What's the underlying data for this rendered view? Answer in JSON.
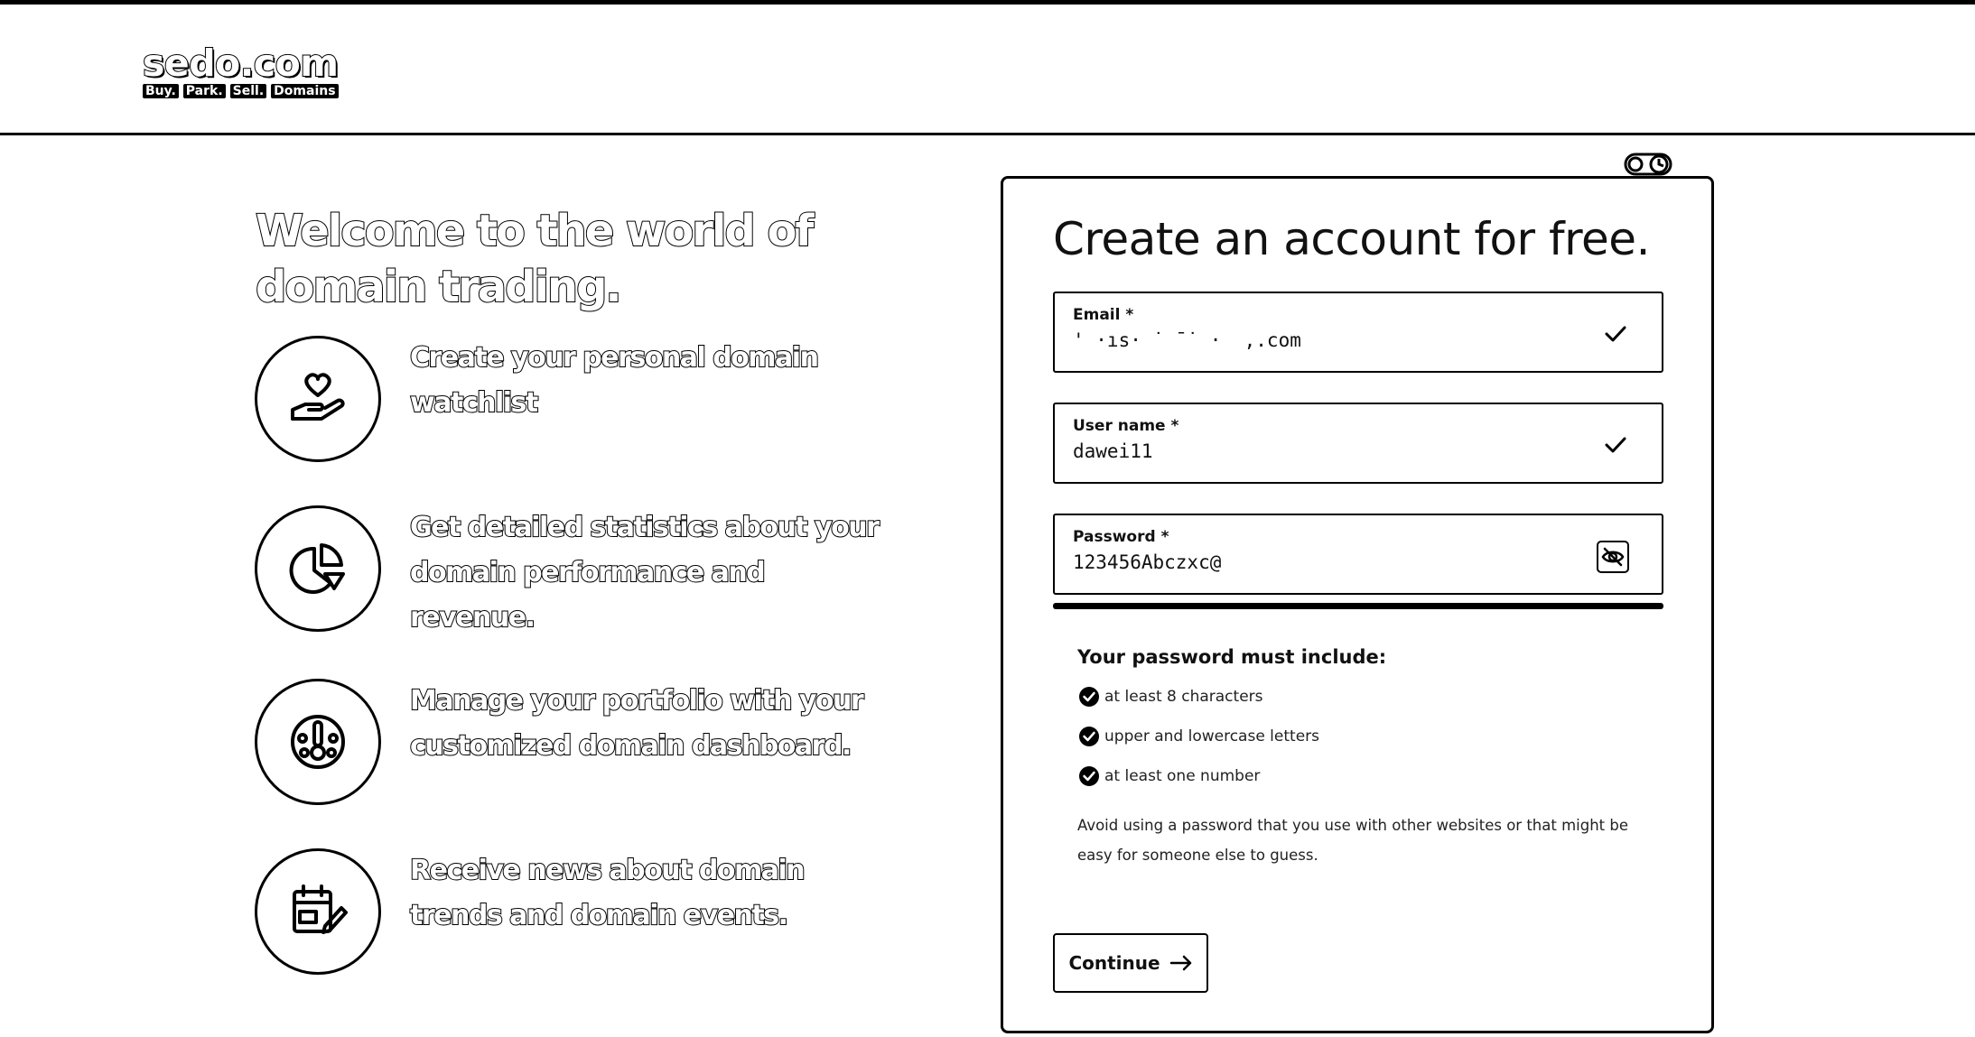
{
  "header": {
    "logo": {
      "word": "sedo.com",
      "tags": [
        "Buy.",
        "Park.",
        "Sell.",
        "Domains"
      ]
    }
  },
  "hero": {
    "title": "Welcome to the world of domain trading."
  },
  "features": [
    {
      "icon": "hand-heart-icon",
      "text": "Create your personal domain watchlist"
    },
    {
      "icon": "pie-chart-icon",
      "text": "Get detailed statistics about your domain performance and revenue."
    },
    {
      "icon": "dashboard-gauge-icon",
      "text": "Manage your portfolio with your customized domain dashboard."
    },
    {
      "icon": "calendar-edit-icon",
      "text": "Receive news about domain trends and domain events."
    }
  ],
  "form": {
    "title": "Create an account for free.",
    "email": {
      "label": "Email *",
      "value": "' ·ıs· ˙ ˉ˙ ·  ,.com",
      "status_icon": "check-icon"
    },
    "username": {
      "label": "User name *",
      "value": "dawei11",
      "status_icon": "check-icon"
    },
    "password": {
      "label": "Password *",
      "value": "123456Abczxc@",
      "toggle_icon": "eye-off-icon"
    },
    "rules_title": "Your password must include:",
    "rules": [
      "at least 8 characters",
      "upper and lowercase letters",
      "at least one number"
    ],
    "hint": "Avoid using a password that you use with other websites or that might be easy for someone else to guess.",
    "continue_label": "Continue",
    "continue_icon": "arrow-right-icon"
  },
  "colors": {
    "ink": "#000000",
    "background": "#ffffff"
  }
}
